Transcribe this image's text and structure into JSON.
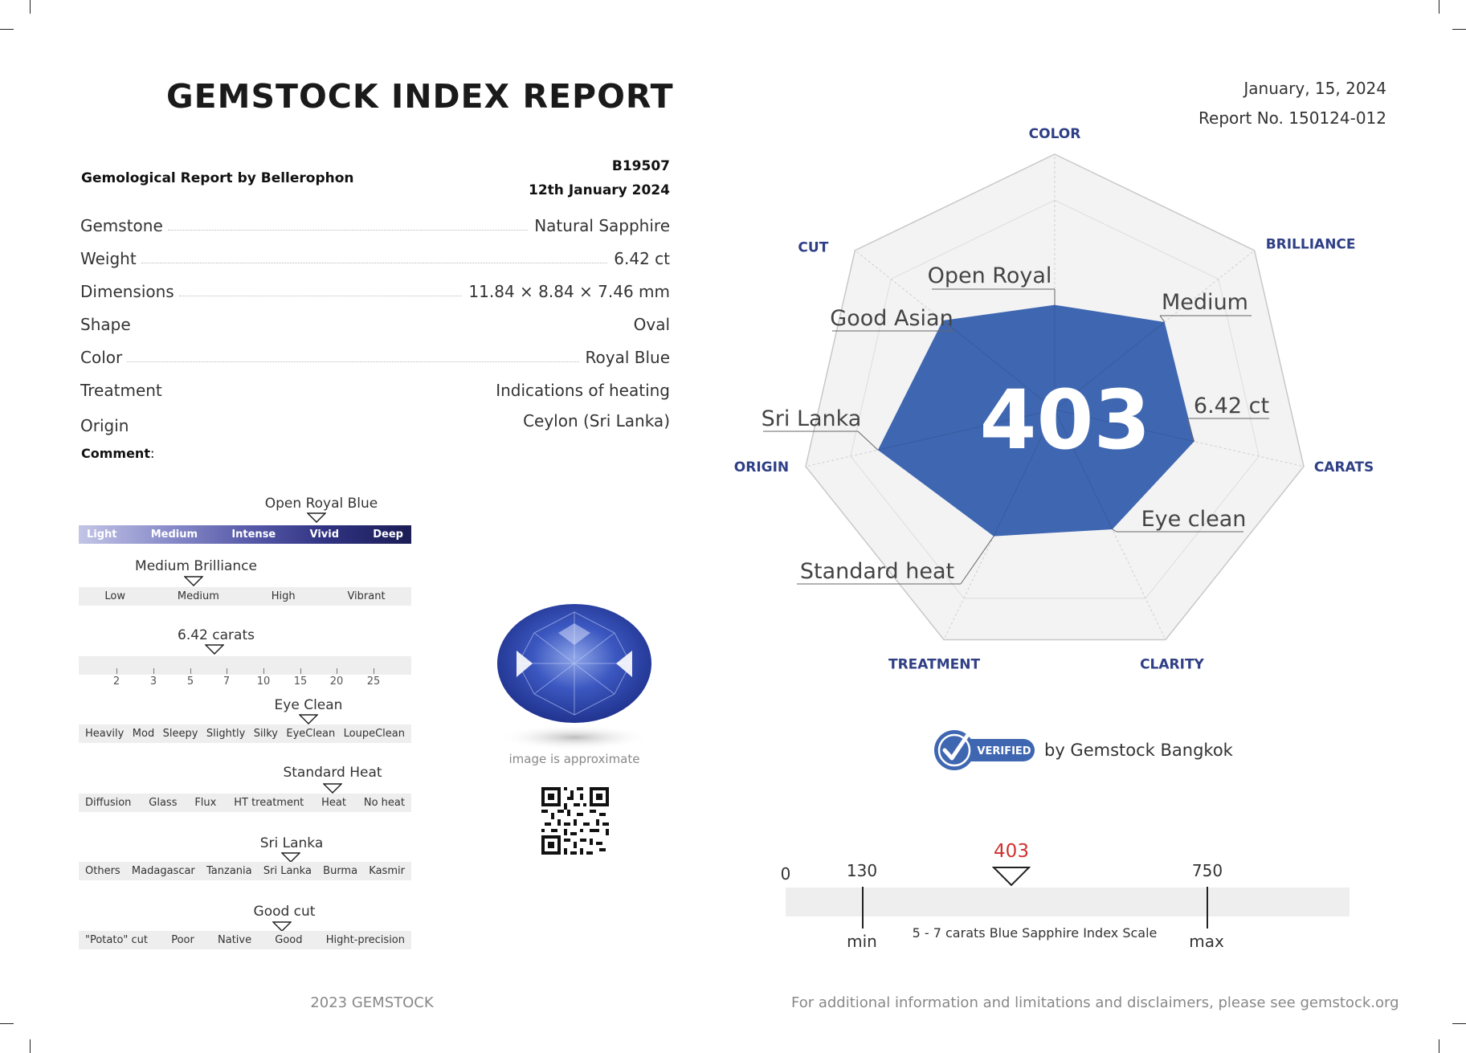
{
  "header": {
    "title": "GEMSTOCK INDEX REPORT",
    "date": "January, 15, 2024",
    "report_no": "Report No. 150124-012"
  },
  "gemological": {
    "by": "Gemological Report by Bellerophon",
    "code": "B19507",
    "date": "12th January 2024",
    "rows": [
      {
        "key": "Gemstone",
        "value": "Natural Sapphire"
      },
      {
        "key": "Weight",
        "value": "6.42 ct"
      },
      {
        "key": "Dimensions",
        "value": "11.84 × 8.84 × 7.46 mm"
      },
      {
        "key": "Shape",
        "value": "Oval"
      },
      {
        "key": "Color",
        "value": "Royal Blue"
      },
      {
        "key": "Treatment",
        "value": "Indications of heating"
      },
      {
        "key": "Origin",
        "value": "Ceylon (Sri Lanka)"
      }
    ],
    "comment_label": "Comment",
    "comment_suffix": ":"
  },
  "scales": {
    "color": {
      "marker": "Open Royal Blue",
      "items": [
        "Light",
        "Medium",
        "Intense",
        "Vivid",
        "Deep"
      ]
    },
    "brilliance": {
      "marker": "Medium Brilliance",
      "items": [
        "Low",
        "Medium",
        "High",
        "Vibrant"
      ]
    },
    "carats": {
      "marker": "6.42 carats",
      "ticks": [
        "2",
        "3",
        "5",
        "7",
        "10",
        "15",
        "20",
        "25"
      ]
    },
    "clarity": {
      "marker": "Eye Clean",
      "items": [
        "Heavily",
        "Mod",
        "Sleepy",
        "Slightly",
        "Silky",
        "EyeClean",
        "LoupeClean"
      ]
    },
    "treatment": {
      "marker": "Standard Heat",
      "items": [
        "Diffusion",
        "Glass",
        "Flux",
        "HT treatment",
        "Heat",
        "No heat"
      ]
    },
    "origin": {
      "marker": "Sri Lanka",
      "items": [
        "Others",
        "Madagascar",
        "Tanzania",
        "Sri Lanka",
        "Burma",
        "Kasmir"
      ]
    },
    "cut": {
      "marker": "Good cut",
      "items": [
        "\"Potato\" cut",
        "Poor",
        "Native",
        "Good",
        "Hight-precision"
      ]
    }
  },
  "image_note": "image is approximate",
  "radar": {
    "score": "403",
    "axes": [
      "COLOR",
      "BRILLIANCE",
      "CARATS",
      "CLARITY",
      "TREATMENT",
      "ORIGIN",
      "CUT"
    ],
    "values": [
      0.41,
      0.55,
      0.56,
      0.52,
      0.55,
      0.71,
      0.56
    ],
    "annotations": {
      "color": "Open Royal",
      "brilliance": "Medium",
      "carats": "6.42 ct",
      "clarity": "Eye clean",
      "treatment": "Standard heat",
      "origin": "Sri Lanka",
      "cut": "Good Asian"
    },
    "fill_color": "#3f67b1",
    "axis_label_color": "#2f3f86"
  },
  "verified": {
    "badge": "VERIFIED",
    "text": "by Gemstock Bangkok"
  },
  "index_scale": {
    "zero": "0",
    "min_value": "130",
    "max_value": "750",
    "current": "403",
    "min_label": "min",
    "max_label": "max",
    "caption": "5 - 7 carats Blue Sapphire Index Scale",
    "current_color": "#d0312d"
  },
  "footer": {
    "left": "2023 GEMSTOCK",
    "right": "For additional information and limitations and disclaimers, please see gemstock.org"
  }
}
